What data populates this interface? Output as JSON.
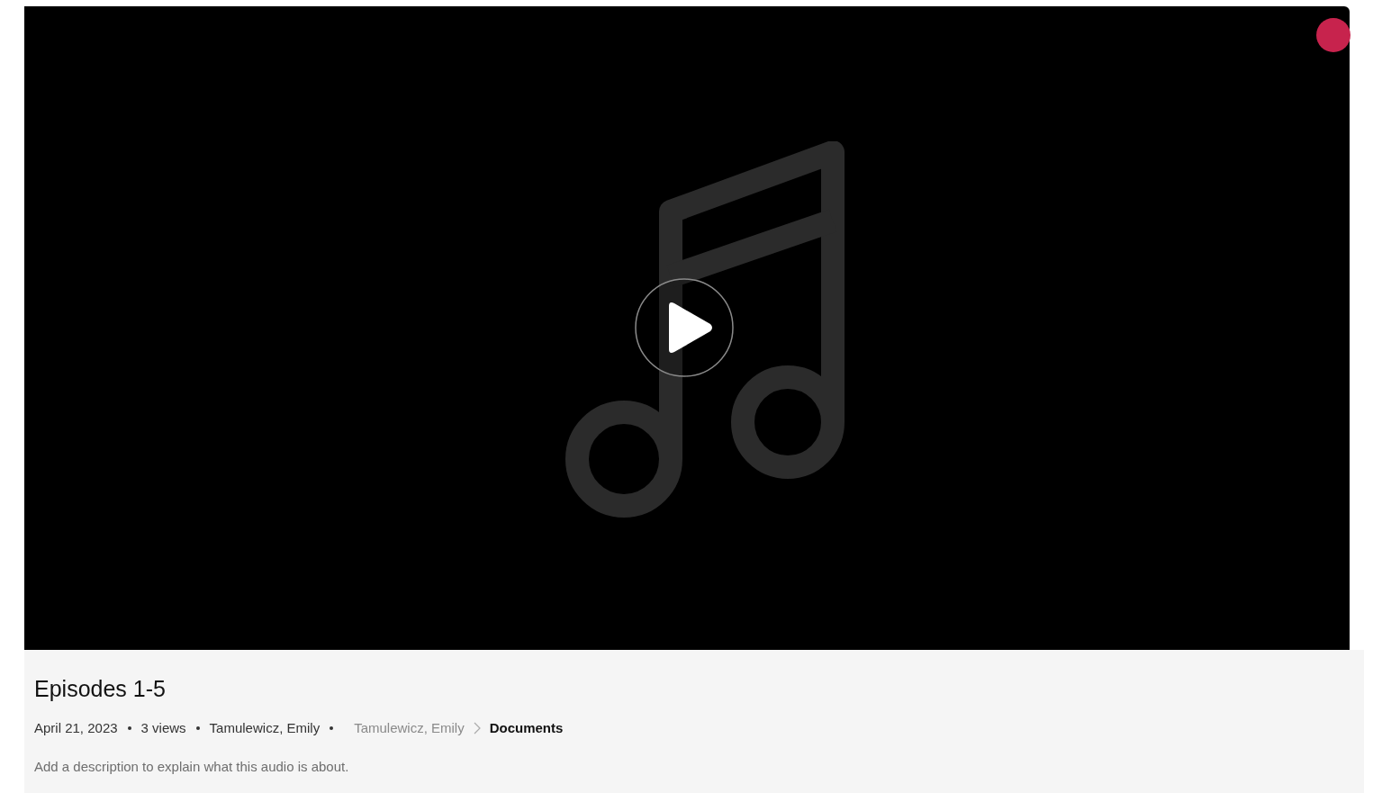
{
  "title": "Episodes 1-5",
  "meta": [
    "April 21, 2023",
    "3 views",
    "Tamulewicz, Emily"
  ],
  "breadcrumb": [
    {
      "label": "Tamulewicz, Emily",
      "current": false
    },
    {
      "label": "Documents",
      "current": true
    }
  ],
  "description": "Add a description to explain what this audio is about."
}
